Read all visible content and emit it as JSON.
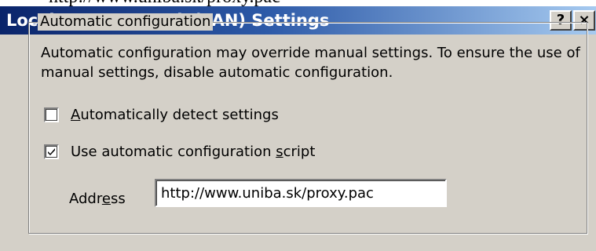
{
  "header_fragment": "http://www.uniba.sk/proxy.pac",
  "window": {
    "title": "Local Area Network (LAN) Settings",
    "help_label": "?",
    "close_label": "×"
  },
  "automatic_configuration": {
    "group_title": "Automatic configuration",
    "description": "Automatic configuration may override manual settings.  To ensure the use of manual settings, disable automatic configuration.",
    "auto_detect": {
      "label_pre": "",
      "label_accel": "A",
      "label_post": "utomatically detect settings",
      "checked": false
    },
    "use_script": {
      "label_pre": "Use automatic configuration ",
      "label_accel": "s",
      "label_post": "cript",
      "checked": true
    },
    "address": {
      "label_pre": "Addr",
      "label_accel": "e",
      "label_post": "ss",
      "value": "http://www.uniba.sk/proxy.pac"
    }
  },
  "colors": {
    "title_bar_start": "#0a246a",
    "title_bar_end": "#a6caf0",
    "dialog_face": "#d4d0c8"
  }
}
